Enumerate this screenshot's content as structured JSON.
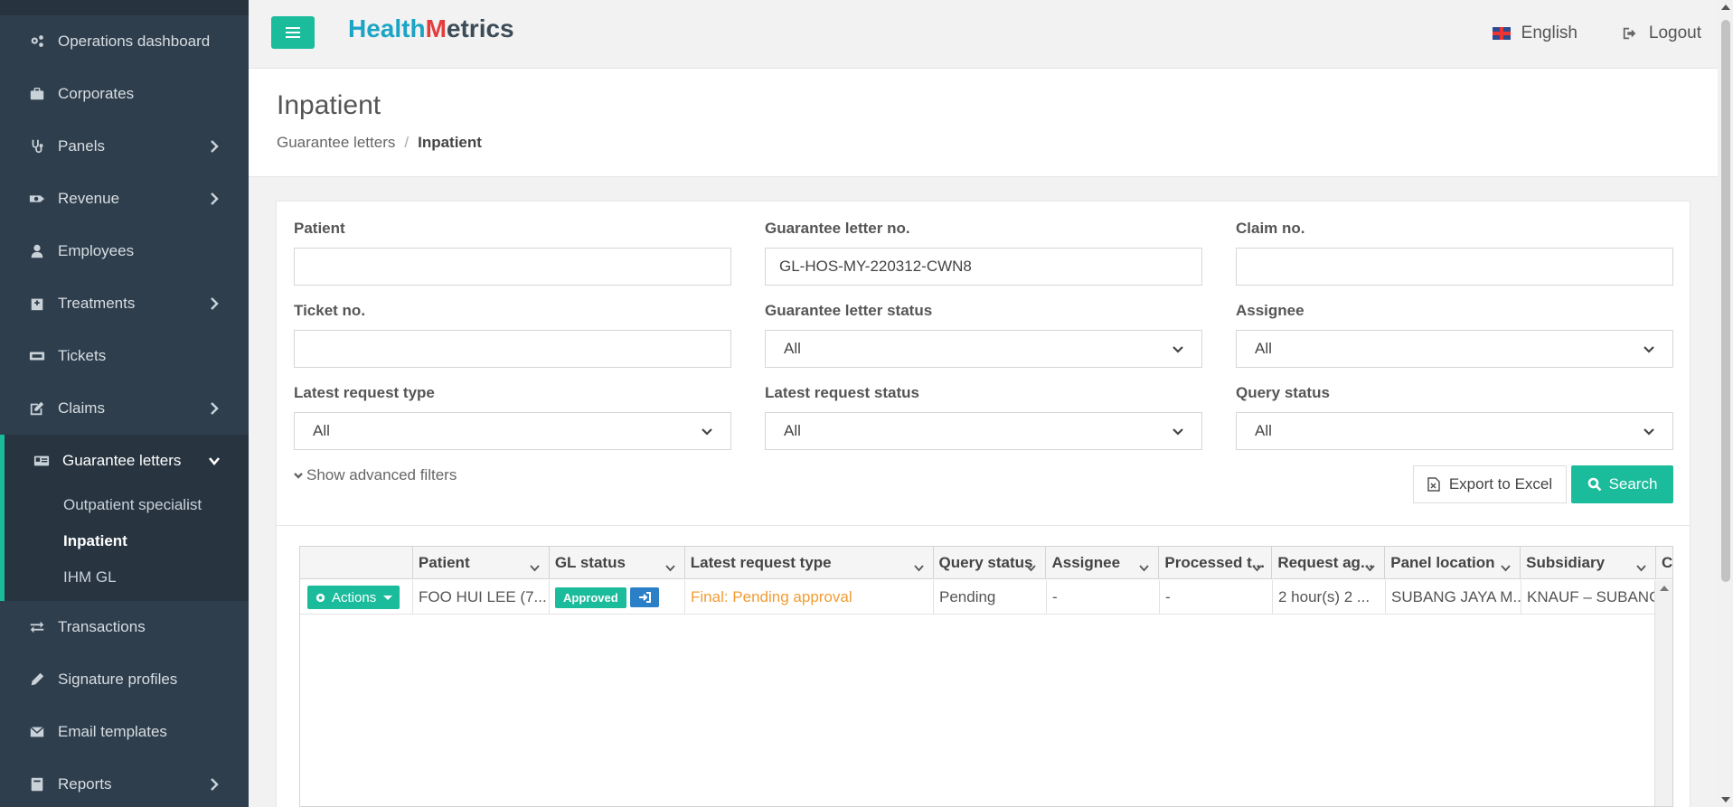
{
  "sidebar": {
    "items": [
      {
        "label": "Operations dashboard",
        "icon": "cogs-icon",
        "has_children": false
      },
      {
        "label": "Corporates",
        "icon": "briefcase-icon",
        "has_children": false
      },
      {
        "label": "Panels",
        "icon": "stethoscope-icon",
        "has_children": true
      },
      {
        "label": "Revenue",
        "icon": "money-icon",
        "has_children": true
      },
      {
        "label": "Employees",
        "icon": "user-icon",
        "has_children": false
      },
      {
        "label": "Treatments",
        "icon": "hospital-icon",
        "has_children": true
      },
      {
        "label": "Tickets",
        "icon": "ticket-icon",
        "has_children": false
      },
      {
        "label": "Claims",
        "icon": "edit-icon",
        "has_children": true
      }
    ],
    "active_group": {
      "label": "Guarantee letters",
      "icon": "id-card-icon",
      "children": [
        "Outpatient specialist",
        "Inpatient",
        "IHM GL"
      ],
      "active_child": "Inpatient"
    },
    "items_after": [
      {
        "label": "Transactions",
        "icon": "exchange-icon",
        "has_children": false
      },
      {
        "label": "Signature profiles",
        "icon": "pencil-icon",
        "has_children": false
      },
      {
        "label": "Email templates",
        "icon": "envelope-icon",
        "has_children": false
      },
      {
        "label": "Reports",
        "icon": "book-icon",
        "has_children": true
      }
    ],
    "accent_color": "#1abc9c",
    "bg_color": "#2f3e4c"
  },
  "header": {
    "logo_part1": "Health",
    "logo_part2": "M",
    "logo_part3": "etrics",
    "language": "English",
    "logout": "Logout"
  },
  "page": {
    "title": "Inpatient",
    "breadcrumb": [
      "Guarantee letters",
      "Inpatient"
    ]
  },
  "filters": {
    "patient": {
      "label": "Patient",
      "value": ""
    },
    "gl_no": {
      "label": "Guarantee letter no.",
      "value": "GL-HOS-MY-220312-CWN8"
    },
    "claim_no": {
      "label": "Claim no.",
      "value": ""
    },
    "ticket_no": {
      "label": "Ticket no.",
      "value": ""
    },
    "gl_status": {
      "label": "Guarantee letter status",
      "value": "All"
    },
    "assignee": {
      "label": "Assignee",
      "value": "All"
    },
    "latest_request_type": {
      "label": "Latest request type",
      "value": "All"
    },
    "latest_request_status": {
      "label": "Latest request status",
      "value": "All"
    },
    "query_status": {
      "label": "Query status",
      "value": "All"
    },
    "advanced": "Show advanced filters",
    "export_label": "Export to Excel",
    "search_label": "Search"
  },
  "table": {
    "columns": [
      "",
      "Patient",
      "GL status",
      "Latest request type",
      "Query status",
      "Assignee",
      "Processed t...",
      "Request ag...",
      "Panel location",
      "Subsidiary",
      "C"
    ],
    "rows": [
      {
        "actions": "Actions",
        "patient": "FOO HUI LEE  (7...",
        "gl_status": "Approved",
        "latest_request_type": "Final: Pending approval",
        "query_status": "Pending",
        "assignee": "-",
        "processed": "-",
        "request_age": "2 hour(s) 2 ...",
        "panel_location": "SUBANG JAYA M...",
        "subsidiary": "KNAUF – SUBANG"
      }
    ]
  },
  "colors": {
    "primary": "#1abc9c",
    "info": "#2a7fc7",
    "warning_text": "#f39c33"
  }
}
